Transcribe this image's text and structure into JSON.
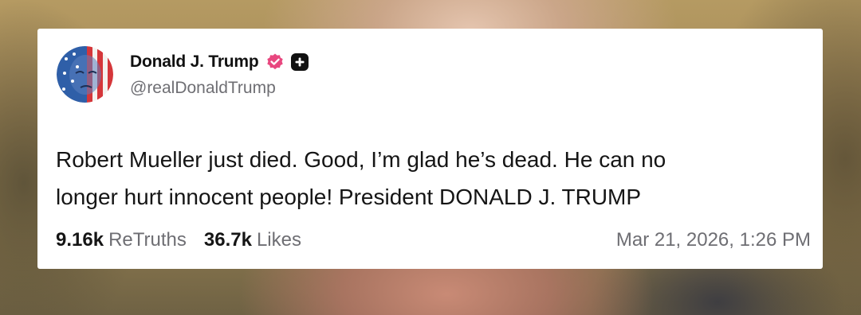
{
  "post": {
    "author": {
      "display_name": "Donald J. Trump",
      "handle": "@realDonaldTrump",
      "avatar_icon": "avatar-flag-portrait",
      "verified_icon": "verified-badge-icon",
      "verified_color": "#e8477f",
      "plus_icon": "plus-badge-icon"
    },
    "text_line1": "Robert Mueller just died. Good, I’m glad he’s dead. He can no",
    "text_line2": "longer hurt innocent people! President DONALD J. TRUMP",
    "stats": {
      "retruths_count": "9.16k",
      "retruths_label": "ReTruths",
      "likes_count": "36.7k",
      "likes_label": "Likes"
    },
    "timestamp": "Mar 21, 2026, 1:26 PM"
  },
  "colors": {
    "card_bg": "#ffffff",
    "text_primary": "#151515",
    "text_secondary": "#6e6e73",
    "verified": "#e8477f"
  }
}
